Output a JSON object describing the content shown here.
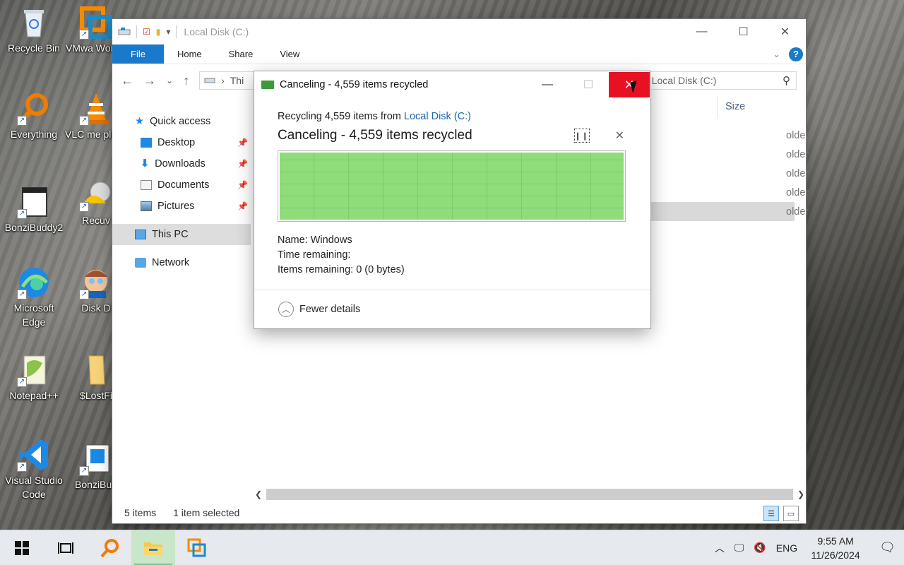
{
  "desktop": {
    "icons": [
      {
        "label": "Recycle Bin"
      },
      {
        "label": "VMwa Workst"
      },
      {
        "label": "Everything"
      },
      {
        "label": "VLC me playe"
      },
      {
        "label": "BonziBuddy2"
      },
      {
        "label": "Recuv"
      },
      {
        "label": "Microsoft Edge"
      },
      {
        "label": "Disk D"
      },
      {
        "label": "Notepad++"
      },
      {
        "label": "$LostFi"
      },
      {
        "label": "Visual Studio Code"
      },
      {
        "label": "BonziBud"
      }
    ]
  },
  "explorer": {
    "title": "Local Disk (C:)",
    "ribbon": {
      "file": "File",
      "home": "Home",
      "share": "Share",
      "view": "View",
      "help": "?"
    },
    "address": "Thi",
    "search_placeholder": "Search Local Disk (C:)",
    "search_visible": "h Local Disk (C:)",
    "nav": {
      "quick_access": "Quick access",
      "desktop": "Desktop",
      "downloads": "Downloads",
      "documents": "Documents",
      "pictures": "Pictures",
      "this_pc": "This PC",
      "network": "Network"
    },
    "column_size": "Size",
    "rows": [
      "older",
      "older",
      "older",
      "older",
      "older"
    ],
    "status": {
      "items": "5 items",
      "selected": "1 item selected"
    }
  },
  "dialog": {
    "title": "Canceling - 4,559 items recycled",
    "line1_prefix": "Recycling 4,559 items from ",
    "line1_link": "Local Disk (C:)",
    "heading": "Canceling - 4,559 items recycled",
    "progress_fraction": 1.0,
    "name_label": "Name:",
    "name_value": "Windows",
    "time_label": "Time remaining:",
    "time_value": "",
    "items_label": "Items remaining:",
    "items_value": "0 (0 bytes)",
    "fewer_details": "Fewer details"
  },
  "taskbar": {
    "language": "ENG",
    "time": "9:55 AM",
    "date": "11/26/2024"
  }
}
